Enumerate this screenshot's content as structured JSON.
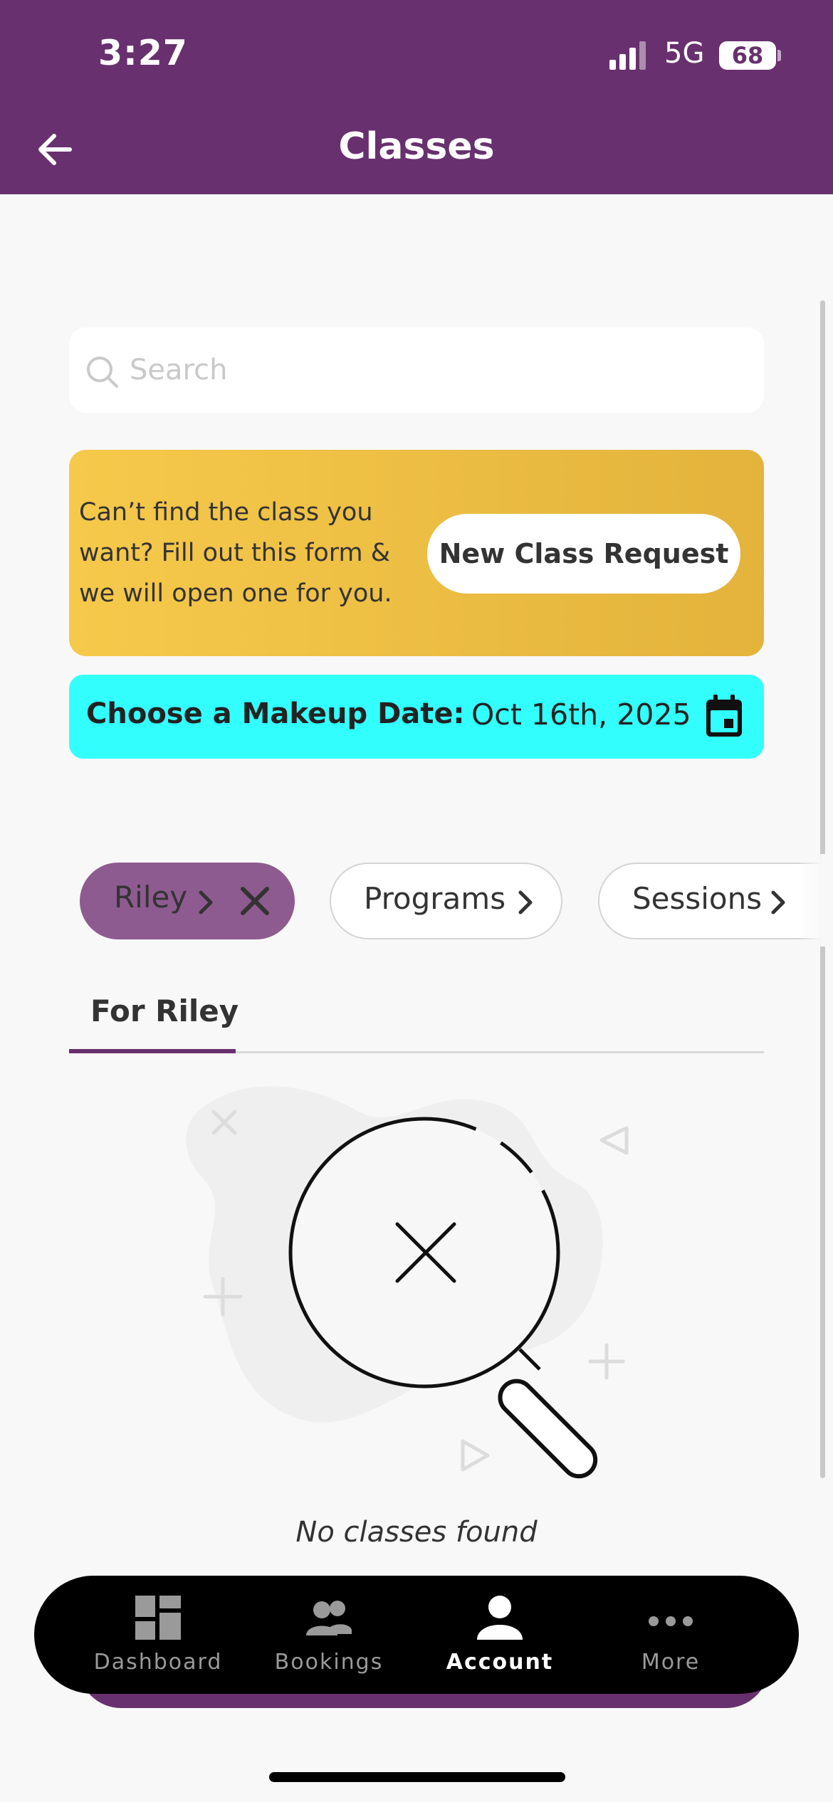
{
  "status_bar": {
    "time": "3:27",
    "network": "5G",
    "battery": "68"
  },
  "header": {
    "title": "Classes",
    "back_icon": "arrow-left-icon"
  },
  "search": {
    "placeholder": "Search",
    "value": ""
  },
  "promo": {
    "text": "Can’t find the class you want? Fill out this form & we will open one for you.",
    "button_label": "New Class Request",
    "gradient": [
      "#f6c94b",
      "#e3b33b"
    ]
  },
  "makeup": {
    "label": "Choose a Makeup Date:",
    "date": "Oct 16th, 2025",
    "color": "#33fefe"
  },
  "filters": {
    "riley": "Riley",
    "programs": "Programs",
    "sessions": "Sessions"
  },
  "tabs": [
    {
      "label": "For Riley",
      "active": true
    }
  ],
  "empty_state": {
    "message": "No classes found"
  },
  "bottom_nav": [
    {
      "label": "Dashboard",
      "icon": "dashboard-icon",
      "active": false
    },
    {
      "label": "Bookings",
      "icon": "people-icon",
      "active": false
    },
    {
      "label": "Account",
      "icon": "person-icon",
      "active": true
    },
    {
      "label": "More",
      "icon": "more-dots-icon",
      "active": false
    }
  ],
  "colors": {
    "brand": "#68306e",
    "chip_active": "#8e5b90",
    "accent_cyan": "#33fefe"
  }
}
